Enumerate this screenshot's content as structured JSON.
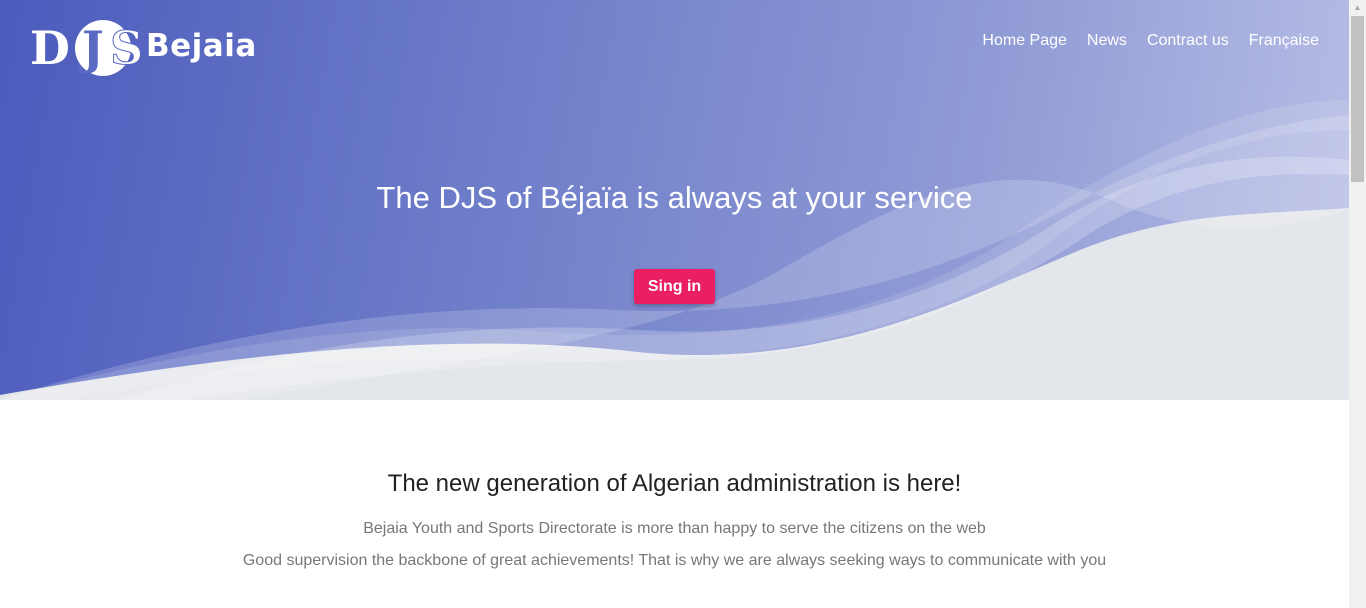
{
  "header": {
    "logo_text": "Bejaia",
    "logo_mark": "DJS"
  },
  "nav": {
    "items": [
      {
        "label": "Home Page"
      },
      {
        "label": "News"
      },
      {
        "label": "Contract us"
      },
      {
        "label": "Française"
      }
    ]
  },
  "hero": {
    "title": "The DJS of Béjaïa is always at your service",
    "button_label": "Sing in"
  },
  "intro": {
    "heading": "The new generation of Algerian administration is here!",
    "line1": "Bejaia Youth and Sports Directorate is more than happy to serve the citizens on the web",
    "line2": "Good supervision the backbone of great achievements! That is why we are always seeking ways to communicate with you"
  },
  "colors": {
    "hero_start": "#4c5bbd",
    "hero_end": "#b9bfe6",
    "button": "#e91e63",
    "wave_fill": "#e3e6ea"
  }
}
